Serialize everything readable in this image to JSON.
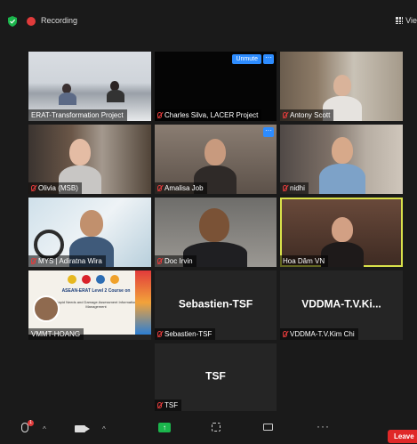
{
  "top_bar": {
    "recording_label": "Recording",
    "view_label": "Vie"
  },
  "tiles": [
    {
      "name": "ERAT-Transformation Project",
      "muted": false
    },
    {
      "name": "Charles Silva, LACER Project",
      "muted": true,
      "unmute_label": "Unmute",
      "more_label": "···"
    },
    {
      "name": "Antony Scott",
      "muted": true
    },
    {
      "name": "Olivia (MSB)",
      "muted": true
    },
    {
      "name": "Amalisa Job",
      "muted": true,
      "more_label": "···"
    },
    {
      "name": "nidhi",
      "muted": true
    },
    {
      "name": "MYS | Adiratna Wira",
      "muted": true
    },
    {
      "name": "Doc Irvin",
      "muted": true
    },
    {
      "name": "Hoa Dâm VN",
      "muted": false,
      "active_speaker": true
    },
    {
      "name": "VMMT-HOANG",
      "muted": false
    },
    {
      "name": "Sebastien-TSF",
      "muted": true,
      "display_name": "Sebastien-TSF"
    },
    {
      "name": "VDDMA-T.V.Kim Chi",
      "muted": true,
      "display_name": "VDDMA-T.V.Ki..."
    },
    {
      "name": "TSF",
      "muted": true,
      "display_name": "TSF"
    }
  ],
  "slide": {
    "title": "ASEAN-ERAT Level 2 Course on",
    "subtitle": "Rapid Needs and Damage Assessment Information Management"
  },
  "toolbar": {
    "mic_badge": "1",
    "caret": "^",
    "more_label": "···",
    "leave_label": "Leave"
  },
  "colors": {
    "accent": "#2d8cff",
    "recording": "#e03b3b",
    "active_speaker_border": "#d9e14a",
    "share": "#1bb54c",
    "leave": "#e02828"
  }
}
